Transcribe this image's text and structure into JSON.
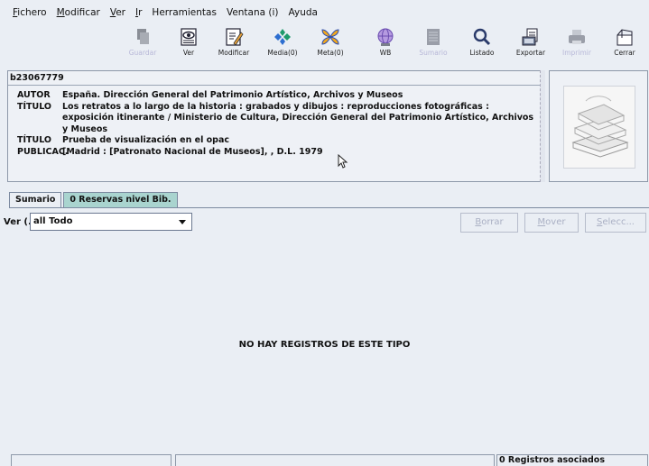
{
  "menu": [
    {
      "mnemonic": "F",
      "rest": "ichero"
    },
    {
      "mnemonic": "M",
      "rest": "odificar"
    },
    {
      "mnemonic": "V",
      "rest": "er"
    },
    {
      "mnemonic": "I",
      "rest": "r"
    },
    {
      "mnemonic": "",
      "rest": "Herramientas"
    },
    {
      "mnemonic": "",
      "rest": "Ventana (i)"
    },
    {
      "mnemonic": "",
      "rest": "Ayuda"
    }
  ],
  "toolbar": {
    "guardar": {
      "label": "Guardar",
      "icon": "save-icon",
      "enabled": false
    },
    "ver": {
      "label": "Ver",
      "icon": "eye-icon",
      "enabled": true
    },
    "modificar": {
      "label": "Modificar",
      "icon": "edit-icon",
      "enabled": true
    },
    "media": {
      "label": "Media(0)",
      "icon": "media-icon",
      "enabled": true
    },
    "meta": {
      "label": "Meta(0)",
      "icon": "meta-icon",
      "enabled": true
    },
    "wb": {
      "label": "WB",
      "icon": "web-icon",
      "enabled": true
    },
    "sumario": {
      "label": "Sumario",
      "icon": "summary-icon",
      "enabled": false
    },
    "listado": {
      "label": "Listado",
      "icon": "search-icon",
      "enabled": true
    },
    "exportar": {
      "label": "Exportar",
      "icon": "export-icon",
      "enabled": true
    },
    "imprimir": {
      "label": "Imprimir",
      "icon": "print-icon",
      "enabled": false
    },
    "cerrar": {
      "label": "Cerrar",
      "icon": "close-icon",
      "enabled": true
    }
  },
  "record": {
    "id": "b23067779",
    "autor_key": "AUTOR",
    "autor": "España. Dirección General del Patrimonio Artístico, Archivos y Museos",
    "titulo_key": "TÍTULO",
    "titulo_line1": "Los retratos a lo largo de la historia : grabados y dibujos : reproducciones fotográficas :",
    "titulo_line2": "exposición itinerante / Ministerio de Cultura, Dirección General del Patrimonio Artístico, Archivos",
    "titulo_line3": "y Museos",
    "titulo2_key": "TÍTULO",
    "titulo2": "Prueba de visualización en el opac",
    "publicac_key": "PUBLICAC.",
    "publicac": "[Madrid : [Patronato Nacional de Museos], , D.L. 1979"
  },
  "tabs": {
    "sumario": "Sumario",
    "reservas": "0 Reservas nivel Bib."
  },
  "view": {
    "label": "Ver (...",
    "selected": "all Todo"
  },
  "buttons": {
    "borrar": {
      "mnemonic": "B",
      "rest": "orrar"
    },
    "mover": {
      "mnemonic": "M",
      "rest": "over"
    },
    "selecc": {
      "mnemonic": "S",
      "rest": "elecc..."
    }
  },
  "empty_message": "NO HAY REGISTROS DE ESTE TIPO",
  "status": {
    "associated": "0 Registros asociados"
  }
}
